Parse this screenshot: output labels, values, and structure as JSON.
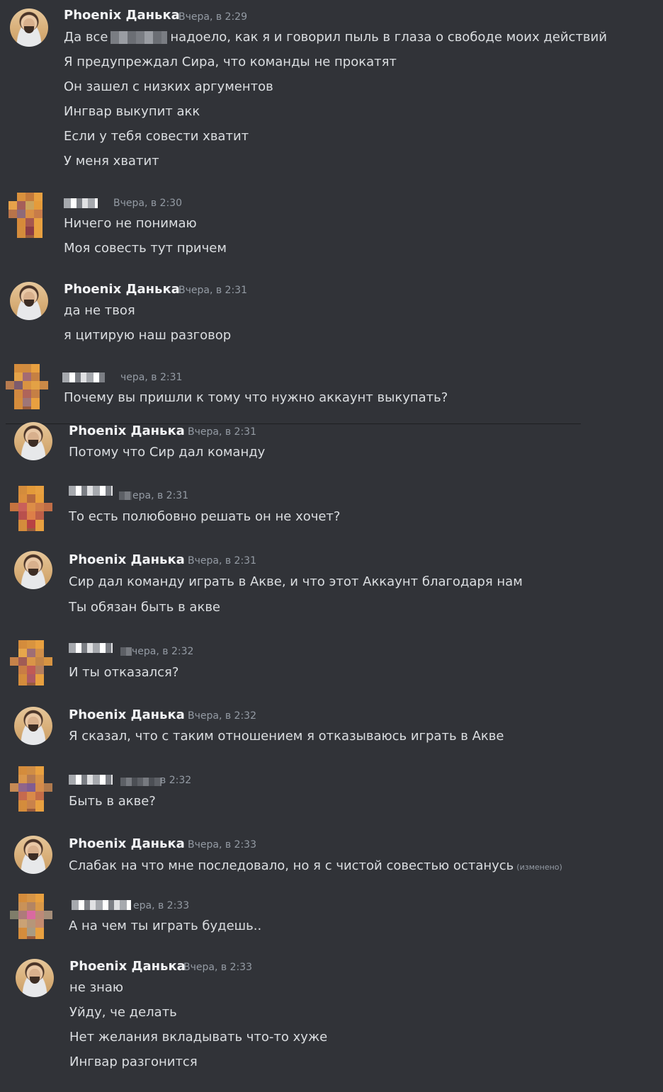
{
  "messages": [
    {
      "author": "Phoenix Данька",
      "time": "Вчера, в 2:29",
      "lines": [
        {
          "before": "Да все",
          "after": "надоело, как я и говорил пыль в глаза о свободе моих действий"
        },
        "Я предупреждал Сира, что команды не прокатят",
        "Он зашел с низких аргументов",
        "Ингвар выкупит акк",
        "Если у тебя совести хватит",
        "У меня хватит"
      ]
    },
    {
      "author": "",
      "time": "Вчера, в 2:30",
      "lines": [
        "Ничего не понимаю",
        "Моя совесть тут причем"
      ]
    },
    {
      "author": "Phoenix Данька",
      "time": "Вчера, в 2:31",
      "lines": [
        "да не твоя",
        "я цитирую наш разговор"
      ]
    },
    {
      "author": "",
      "time": "чера, в 2:31",
      "lines": [
        "Почему вы пришли к тому что нужно аккаунт выкупать?"
      ]
    },
    {
      "author": "Phoenix Данька",
      "time": "Вчера, в 2:31",
      "lines": [
        "Потому что Сир дал команду"
      ]
    },
    {
      "author": "",
      "time": "ера, в 2:31",
      "lines": [
        "То есть полюбовно решать он не хочет?"
      ]
    },
    {
      "author": "Phoenix Данька",
      "time": "Вчера, в 2:31",
      "lines": [
        "Сир дал команду играть в Акве, и что этот Аккаунт благодаря нам",
        "Ты обязан быть в акве"
      ]
    },
    {
      "author": "",
      "time": "чера, в 2:32",
      "lines": [
        "И ты отказался?"
      ]
    },
    {
      "author": "Phoenix Данька",
      "time": "Вчера, в 2:32",
      "lines": [
        "Я сказал, что с таким отношением я отказываюсь играть в Акве"
      ]
    },
    {
      "author": "",
      "time": "в 2:32",
      "lines": [
        "Быть в акве?"
      ]
    },
    {
      "author": "Phoenix Данька",
      "time": "Вчера, в 2:33",
      "lines": [
        "Слабак на что мне последовало, но я с чистой совестью останусь"
      ],
      "edited": "(изменено)"
    },
    {
      "author": "",
      "time": "ера, в 2:33",
      "lines": [
        "А на чем ты играть будешь.."
      ]
    },
    {
      "author": "Phoenix Данька",
      "time": "Вчера, в 2:33",
      "lines": [
        "не знаю",
        "Уйду, че делать",
        "Нет желания вкладывать что-то хуже",
        "Ингвар разгонится"
      ]
    }
  ]
}
